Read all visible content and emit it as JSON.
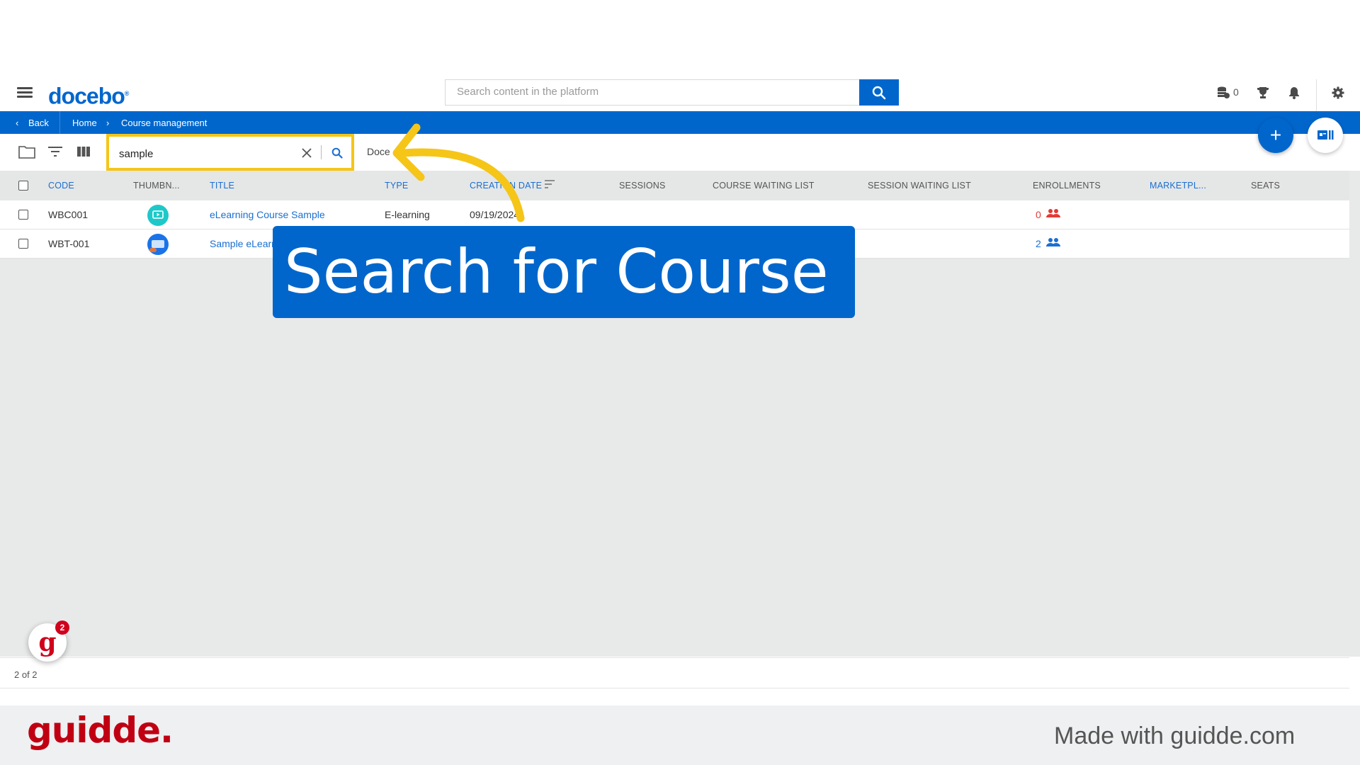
{
  "header": {
    "logo": "docebo",
    "search_placeholder": "Search content in the platform",
    "coins_count": "0",
    "icons": [
      "menu-icon",
      "search-icon",
      "coins-icon",
      "trophy-icon",
      "bell-icon",
      "gear-icon"
    ]
  },
  "breadcrumb": {
    "back_label": "Back",
    "items": [
      "Home",
      "Course management"
    ]
  },
  "toolbar": {
    "search_value": "sample",
    "truncated_text": "Doce",
    "icons": [
      "folder-icon",
      "filter-icon",
      "columns-icon",
      "close-icon",
      "search-icon"
    ]
  },
  "table": {
    "columns": [
      "CODE",
      "THUMBN...",
      "TITLE",
      "TYPE",
      "CREATION DATE",
      "SESSIONS",
      "COURSE WAITING LIST",
      "SESSION WAITING LIST",
      "ENROLLMENTS",
      "MARKETPL...",
      "SEATS"
    ],
    "rows": [
      {
        "code": "WBC001",
        "title": "eLearning Course Sample",
        "type": "E-learning",
        "creation_date": "09/19/2024",
        "enrollments": "0"
      },
      {
        "code": "WBT-001",
        "title": "Sample eLearning",
        "type": "",
        "creation_date": "",
        "enrollments": "2"
      }
    ]
  },
  "pagination": {
    "label": "2 of 2"
  },
  "guidde": {
    "badge_count": "2",
    "brand": "guidde.",
    "made_with": "Made with guidde.com",
    "callout": "Search for Course"
  },
  "colors": {
    "primary": "#0066cc",
    "highlight": "#f5c518",
    "brand_red": "#c00012",
    "alert_red": "#e53935"
  }
}
